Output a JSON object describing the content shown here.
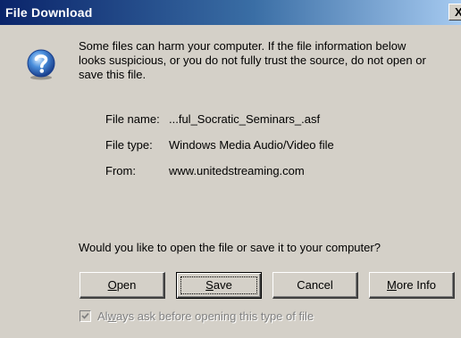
{
  "window": {
    "title": "File Download",
    "close_glyph": "X"
  },
  "icons": {
    "question": "question-icon",
    "close": "close-icon",
    "check": "check-icon"
  },
  "message": {
    "line1": "Some files can harm your computer. If the file information below",
    "line2": "looks suspicious, or you do not fully trust the source, do not open or",
    "line3": "save this file."
  },
  "file_info": {
    "name_label": "File name:",
    "name_value": "...ful_Socratic_Seminars_.asf",
    "type_label": "File type:",
    "type_value": "Windows Media Audio/Video file",
    "from_label": "From:",
    "from_value": "www.unitedstreaming.com"
  },
  "prompt": "Would you like to open the file or save it to your computer?",
  "buttons": {
    "open": {
      "label": "Open",
      "mnemonic": "O",
      "rest": "pen"
    },
    "save": {
      "label": "Save",
      "mnemonic": "S",
      "rest": "ave"
    },
    "cancel": {
      "label": "Cancel"
    },
    "more_info": {
      "label": "More Info",
      "mnemonic": "M",
      "rest": "ore Info"
    }
  },
  "checkbox": {
    "checked": true,
    "label_pre": "Al",
    "mnemonic": "w",
    "label_post": "ays ask before opening this type of file"
  },
  "colors": {
    "dialog_bg": "#d4d0c8",
    "title_start": "#0a246a",
    "title_end": "#a6caf0",
    "disabled_text": "#808080"
  }
}
